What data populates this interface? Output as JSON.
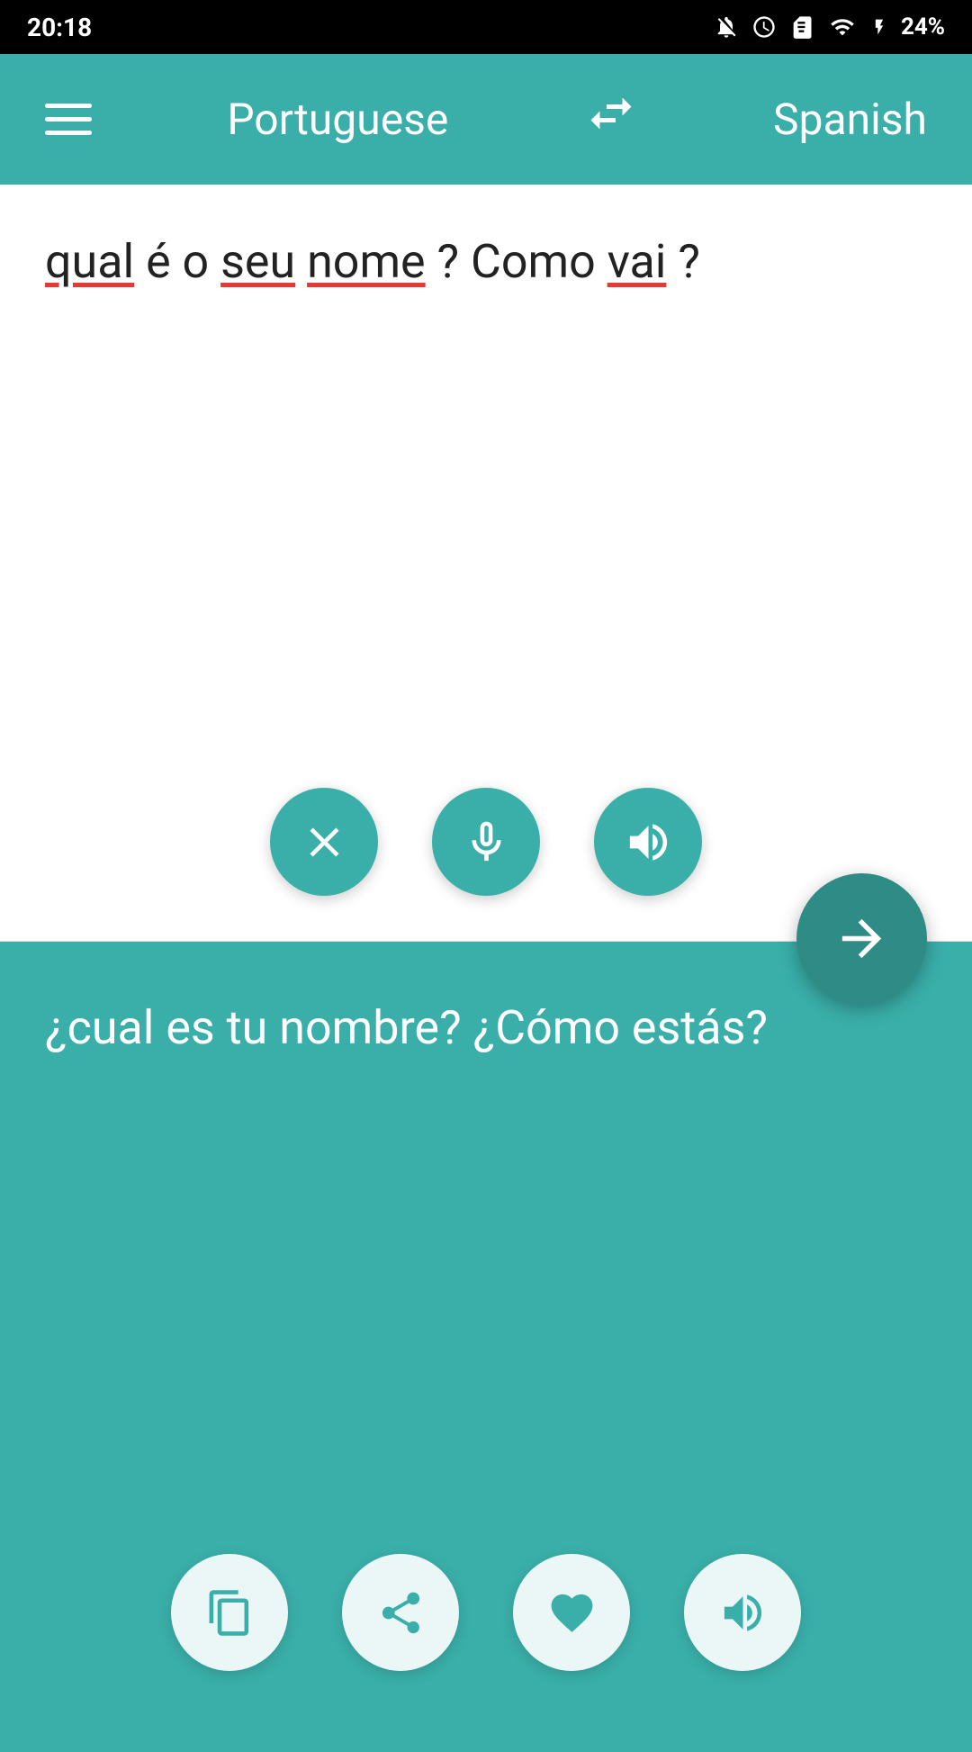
{
  "statusBar": {
    "time": "20:18",
    "battery": "24%"
  },
  "toolbar": {
    "menuLabel": "menu",
    "sourceLang": "Portuguese",
    "swapLabel": "swap languages",
    "targetLang": "Spanish"
  },
  "inputArea": {
    "text": "qual é o seu nome? Como vai?",
    "clearLabel": "clear",
    "micLabel": "microphone",
    "speakLabel": "speak"
  },
  "fab": {
    "label": "translate"
  },
  "outputArea": {
    "text": "¿cual es tu nombre? ¿Cómo estás?",
    "copyLabel": "copy",
    "shareLabel": "share",
    "favoriteLabel": "favorite",
    "speakLabel": "speak output"
  }
}
